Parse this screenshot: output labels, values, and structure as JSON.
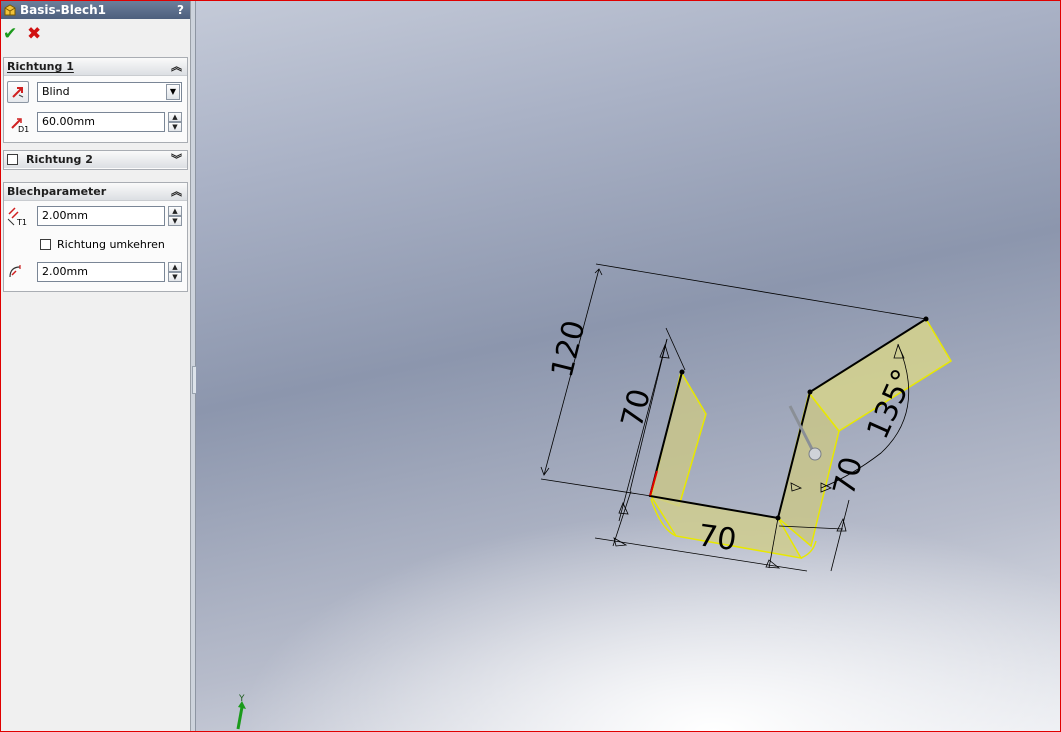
{
  "window": {
    "title": "Basis-Blech1",
    "help": "?",
    "ok_glyph": "✔",
    "cancel_glyph": "✖",
    "border_color": "#e00000"
  },
  "richtung1": {
    "header": "Richtung 1",
    "end_condition": "Blind",
    "depth": "60.00mm",
    "reverse_icon": "reverse-direction-icon",
    "depth_icon": "depth-d1-icon"
  },
  "richtung2": {
    "header": "Richtung 2",
    "checked": false
  },
  "blechparameter": {
    "header": "Blechparameter",
    "thickness": "2.00mm",
    "reverse_label": "Richtung umkehren",
    "reverse_checked": false,
    "bend_radius": "2.00mm",
    "thickness_icon": "thickness-t1-icon",
    "radius_icon": "bend-radius-icon"
  },
  "sketch": {
    "dim_120": "120",
    "dim_70_left": "70",
    "dim_70_bottom": "70",
    "dim_70_right": "70",
    "angle": "135°",
    "highlight_color": "#f2f08a",
    "outline_color": "#e8e800"
  },
  "triad": {
    "y_label": "Y"
  }
}
